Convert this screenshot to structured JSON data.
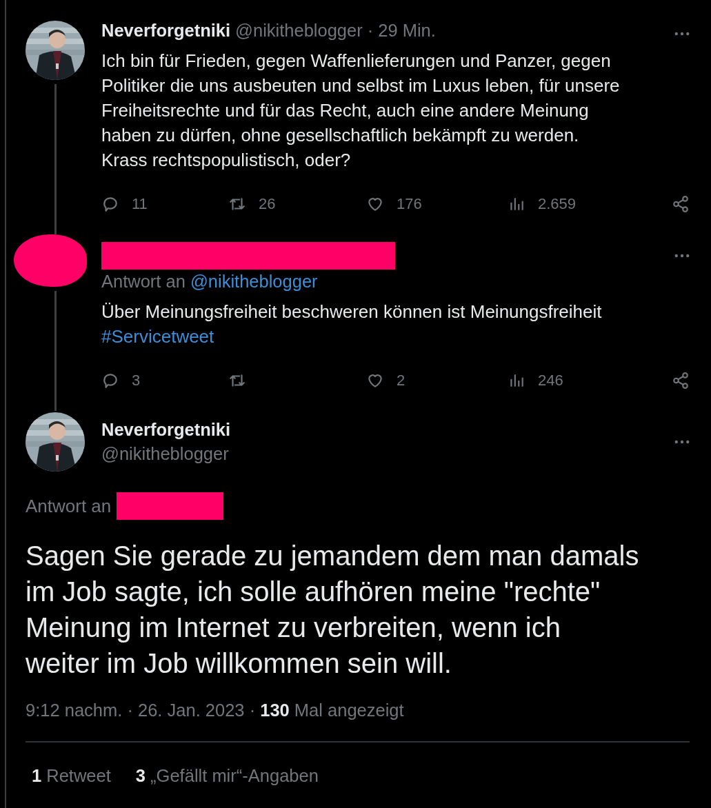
{
  "thread": [
    {
      "author": {
        "name": "Neverforgetniki",
        "handle": "@nikitheblogger",
        "separator": "·",
        "time": "29 Min."
      },
      "text": "Ich bin für Frieden, gegen Waffenlieferungen und Panzer, gegen\nPolitiker die uns ausbeuten und selbst im Luxus leben, für unsere\nFreiheitsrechte und für das Recht, auch eine andere Meinung\nhaben zu dürfen, ohne gesellschaftlich bekämpft zu werden.\nKrass rechtspopulistisch, oder?",
      "actions": {
        "replies": "11",
        "retweets": "26",
        "likes": "176",
        "views": "2.659"
      }
    },
    {
      "author": {
        "redacted": true
      },
      "reply_to": {
        "label": "Antwort an",
        "handle": "@nikitheblogger"
      },
      "text": "Über Meinungsfreiheit beschweren können ist Meinungsfreiheit",
      "hashtag": "#Servicetweet",
      "actions": {
        "replies": "3",
        "likes": "2",
        "views": "246"
      }
    }
  ],
  "main_tweet": {
    "author": {
      "name": "Neverforgetniki",
      "handle": "@nikitheblogger"
    },
    "reply_to": {
      "label": "Antwort an"
    },
    "text": "Sagen Sie gerade zu jemandem dem man damals\nim Job sagte, ich solle aufhören meine \"rechte\"\nMeinung im Internet zu verbreiten, wenn ich\nweiter im Job willkommen sein will.",
    "details": "9:12 nachm. · 26. Jan. 2023 · **130** Mal angezeigt",
    "stats": [
      "**1** Retweet",
      "**3** „Gefällt mir“-Angaben"
    ]
  }
}
